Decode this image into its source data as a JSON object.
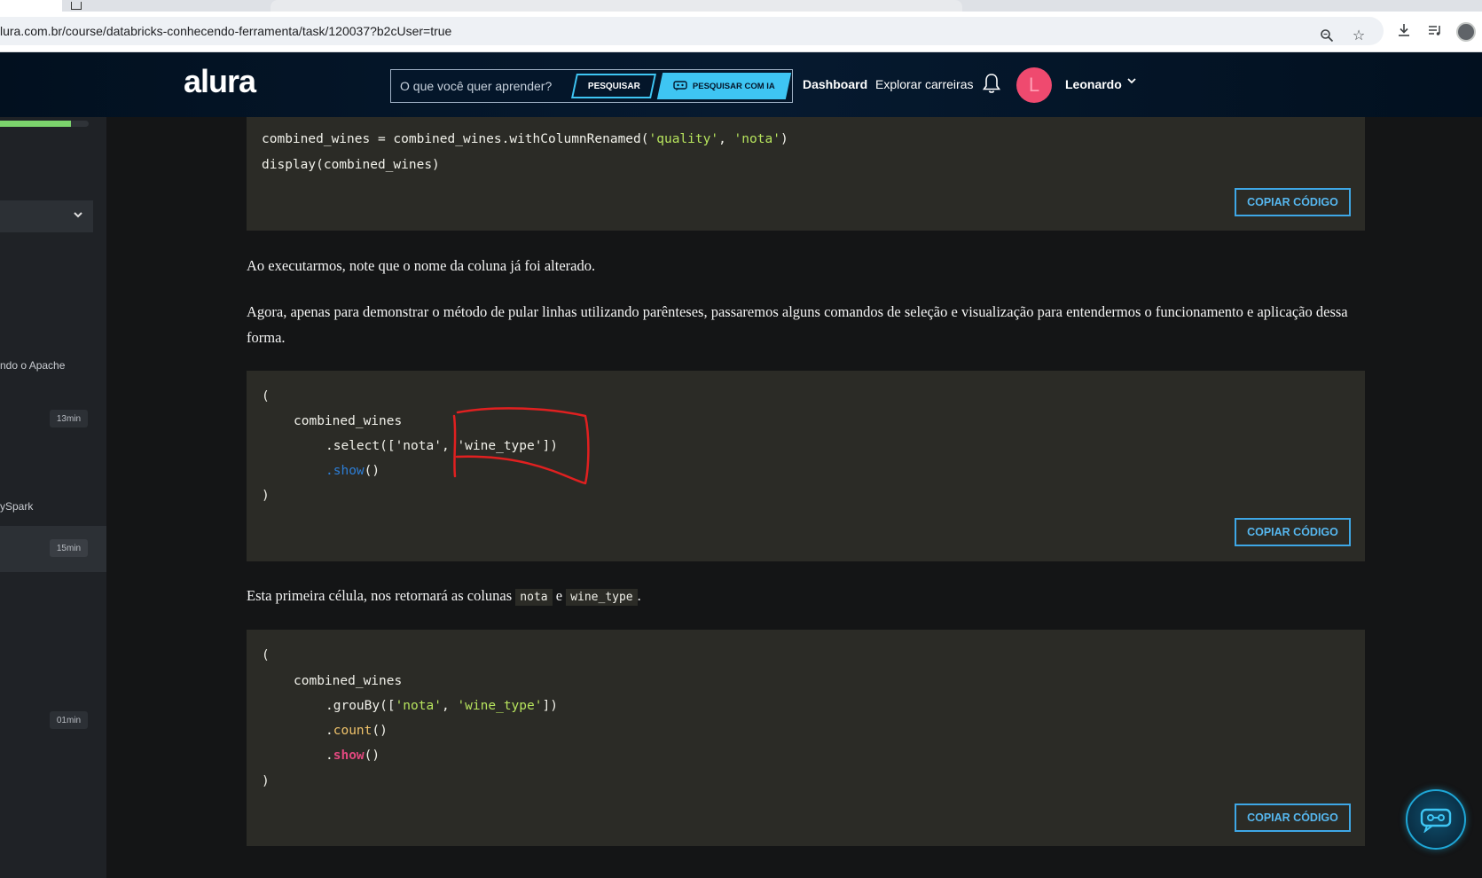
{
  "browser": {
    "url": "lura.com.br/course/databricks-conhecendo-ferramenta/task/120037?b2cUser=true"
  },
  "header": {
    "logo": "alura",
    "search_placeholder": "O que você quer aprender?",
    "search_button": "PESQUISAR",
    "search_ai_button": "PESQUISAR COM IA",
    "nav_dashboard": "Dashboard",
    "nav_careers": "Explorar carreiras",
    "avatar_initial": "L",
    "user_name": "Leonardo"
  },
  "sidebar": {
    "progress": 0.8,
    "items": [
      {
        "text": "ndo o Apache",
        "duration": "13min"
      },
      {
        "text": "ySpark",
        "duration": "15min"
      },
      {
        "text": "",
        "duration": "01min"
      }
    ]
  },
  "content": {
    "copy_label": "COPIAR CÓDIGO",
    "para1": "Ao executarmos, note que o nome da coluna já foi alterado.",
    "para2": "Agora, apenas para demonstrar o método de pular linhas utilizando parênteses, passaremos alguns comandos de seleção e visualização para entendermos o funcionamento e aplicação dessa forma.",
    "para3_prefix": "Esta primeira célula, nos retornará as colunas",
    "para3_code1": "nota",
    "para3_mid": "e",
    "para3_code2": "wine_type",
    "para3_suffix": "."
  },
  "code1": {
    "line1_a": "combined_wines = combined_wines.withColumnRenamed(",
    "line1_s1": "'quality'",
    "line1_sep": ", ",
    "line1_s2": "'nota'",
    "line1_end": ")",
    "line2": "display(combined_wines)"
  },
  "code2": {
    "open": "(",
    "var": "combined_wines",
    "sel_a": ".select([",
    "sel_s1": "'nota'",
    "sel_sep": ", ",
    "sel_s2": "'wine_type'",
    "sel_end": "])",
    "show": ".show",
    "show_paren": "()",
    "close": ")"
  },
  "code3": {
    "open": "(",
    "var": "combined_wines",
    "grp_a": ".grouBy([",
    "grp_s1": "'nota'",
    "grp_sep": ", ",
    "grp_s2": "'wine_type'",
    "grp_end": "])",
    "count_dot": ".",
    "count": "count",
    "count_paren": "()",
    "show_dot": ".",
    "show": "show",
    "show_paren": "()",
    "close": ")"
  },
  "colors": {
    "accent": "#3ec5f3",
    "string": "#b6e35d",
    "annotation": "#e02020"
  }
}
